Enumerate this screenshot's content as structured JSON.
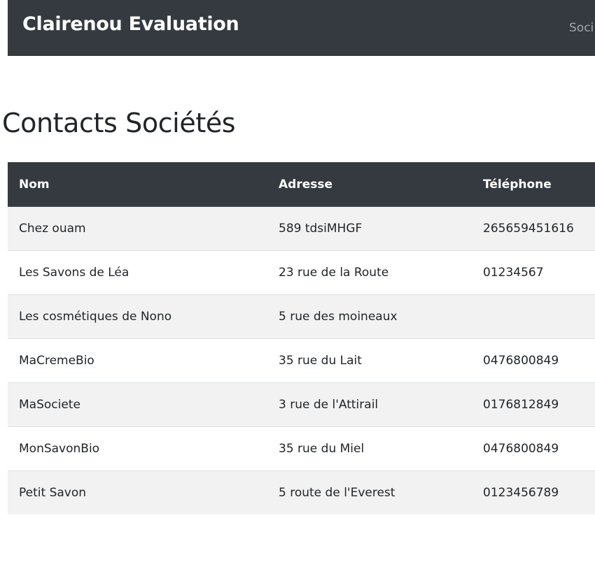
{
  "navbar": {
    "brand": "Clairenou Evaluation",
    "link_partial": "Soci"
  },
  "page_title": "Contacts Sociétés",
  "table": {
    "headers": [
      "Nom",
      "Adresse",
      "Téléphone"
    ],
    "rows": [
      [
        "Chez ouam",
        "589 tdsiMHGF",
        "265659451616"
      ],
      [
        "Les Savons de Léa",
        "23 rue de la Route",
        "01234567"
      ],
      [
        "Les cosmétiques de Nono",
        "5 rue des moineaux",
        ""
      ],
      [
        "MaCremeBio",
        "35 rue du Lait",
        "0476800849"
      ],
      [
        "MaSociete",
        "3 rue de l'Attirail",
        "0176812849"
      ],
      [
        "MonSavonBio",
        "35 rue du Miel",
        "0476800849"
      ],
      [
        "Petit Savon",
        "5 route de l'Everest",
        "0123456789"
      ]
    ]
  },
  "colors": {
    "navbar_bg": "#343a40",
    "header_bg": "#343a40",
    "stripe_bg": "#f2f2f2",
    "text": "#212529"
  }
}
